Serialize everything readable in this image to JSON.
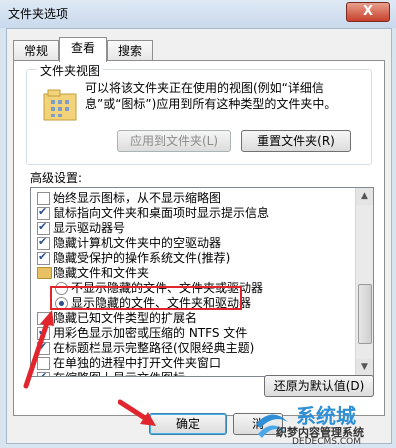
{
  "window": {
    "title": "文件夹选项",
    "close_label": "X"
  },
  "tabs": [
    {
      "label": "常规"
    },
    {
      "label": "查看"
    },
    {
      "label": "搜索"
    }
  ],
  "folder_views": {
    "title": "文件夹视图",
    "description": "可以将该文件夹正在使用的视图(例如“详细信息”或“图标”)应用到所有这种类型的文件夹中。",
    "apply_button": "应用到文件夹(L)",
    "reset_button": "重置文件夹(R)"
  },
  "advanced": {
    "label": "高级设置:",
    "items": [
      {
        "type": "checkbox",
        "checked": false,
        "indent": 1,
        "label": "始终显示图标，从不显示缩略图"
      },
      {
        "type": "checkbox",
        "checked": true,
        "indent": 1,
        "label": "鼠标指向文件夹和桌面项时显示提示信息"
      },
      {
        "type": "checkbox",
        "checked": true,
        "indent": 1,
        "label": "显示驱动器号"
      },
      {
        "type": "checkbox",
        "checked": true,
        "indent": 1,
        "label": "隐藏计算机文件夹中的空驱动器"
      },
      {
        "type": "checkbox",
        "checked": true,
        "indent": 1,
        "label": "隐藏受保护的操作系统文件(推荐)"
      },
      {
        "type": "folder",
        "indent": 1,
        "label": "隐藏文件和文件夹"
      },
      {
        "type": "radio",
        "checked": false,
        "indent": 2,
        "label": "不显示隐藏的文件、文件夹或驱动器"
      },
      {
        "type": "radio",
        "checked": true,
        "indent": 2,
        "label": "显示隐藏的文件、文件夹和驱动器"
      },
      {
        "type": "checkbox",
        "checked": false,
        "indent": 1,
        "label": "隐藏已知文件类型的扩展名"
      },
      {
        "type": "checkbox",
        "checked": true,
        "indent": 1,
        "label": "用彩色显示加密或压缩的 NTFS 文件"
      },
      {
        "type": "checkbox",
        "checked": true,
        "indent": 1,
        "label": "在标题栏显示完整路径(仅限经典主题)"
      },
      {
        "type": "checkbox",
        "checked": false,
        "indent": 1,
        "label": "在单独的进程中打开文件夹窗口"
      },
      {
        "type": "checkbox",
        "checked": true,
        "indent": 1,
        "label": "在缩略图上显示文件图标"
      }
    ]
  },
  "restore_defaults_button": "还原为默认值(D)",
  "ok_button": "确定",
  "cancel_button": "消",
  "watermark": {
    "brand": "系统城",
    "site_text": "织梦内容管理系统",
    "domain": "DEDECMS.COM"
  },
  "colors": {
    "highlight": "#e0262c"
  }
}
